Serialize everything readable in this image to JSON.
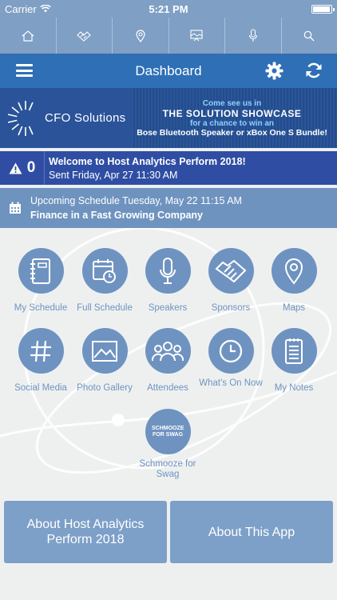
{
  "status": {
    "carrier": "Carrier",
    "time": "5:21 PM"
  },
  "top_nav": {
    "items": [
      {
        "icon": "home-icon"
      },
      {
        "icon": "handshake-icon"
      },
      {
        "icon": "map-pin-icon"
      },
      {
        "icon": "gallery-icon"
      },
      {
        "icon": "microphone-icon"
      },
      {
        "icon": "search-icon"
      }
    ]
  },
  "header": {
    "title": "Dashboard"
  },
  "banner": {
    "brand": "CFO Solutions",
    "line1": "Come see us in",
    "line2": "THE SOLUTION SHOWCASE",
    "line3": "for a chance to win an",
    "line4": "Bose Bluetooth Speaker or xBox One S Bundle!"
  },
  "alert": {
    "count": "0",
    "title": "Welcome to Host Analytics Perform 2018!",
    "sent": "Sent Friday, Apr 27 11:30 AM"
  },
  "schedule": {
    "line1": "Upcoming Schedule Tuesday, May 22 11:15 AM",
    "line2": "Finance in a Fast Growing Company"
  },
  "tiles": [
    {
      "label": "My Schedule",
      "icon": "notebook-icon"
    },
    {
      "label": "Full Schedule",
      "icon": "calendar-clock-icon"
    },
    {
      "label": "Speakers",
      "icon": "microphone-icon"
    },
    {
      "label": "Sponsors",
      "icon": "handshake-icon"
    },
    {
      "label": "Maps",
      "icon": "map-pin-icon"
    },
    {
      "label": "Social Media",
      "icon": "hashtag-icon"
    },
    {
      "label": "Photo Gallery",
      "icon": "photo-icon"
    },
    {
      "label": "Attendees",
      "icon": "group-icon"
    },
    {
      "label": "What's On Now",
      "icon": "clock-icon"
    },
    {
      "label": "My Notes",
      "icon": "notes-icon"
    },
    {
      "label": "Schmooze for Swag",
      "icon": "schmooze-badge",
      "badge": "SCHMOOZE FOR SWAG"
    }
  ],
  "buttons": {
    "about_event": "About Host Analytics Perform 2018",
    "about_app": "About This App"
  },
  "colors": {
    "nav_bg": "#7f9fc4",
    "header_bg": "#2e6fb6",
    "alert_bg": "#2f4ea3",
    "schedule_bg": "#6e93bf",
    "tile": "#6f93c0",
    "background": "#eef0f0"
  }
}
